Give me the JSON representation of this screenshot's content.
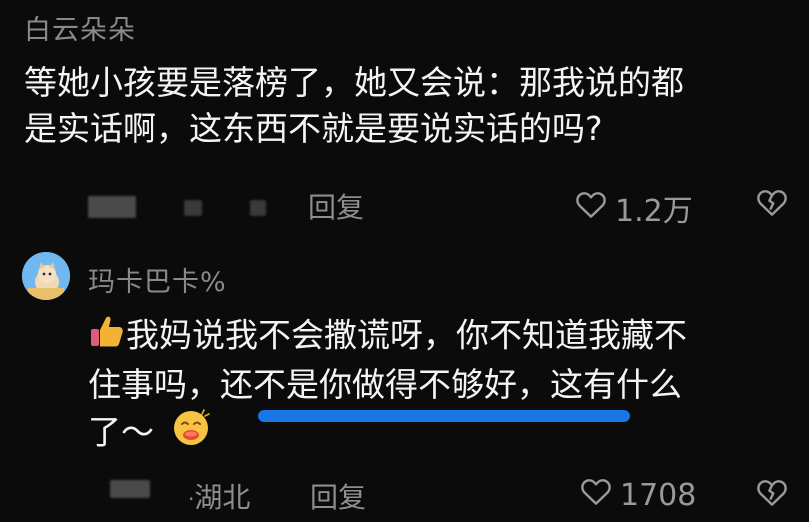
{
  "comments": [
    {
      "author": "白云朵朵",
      "text_line1": "等她小孩要是落榜了，她又会说：那我说的都",
      "text_line2": "是实话啊，这东西不就是要说实话的吗?",
      "reply_label": "回复",
      "like_count": "1.2万"
    },
    {
      "author": "玛卡巴卡%",
      "text_line1": "我妈说我不会撒谎呀，你不知道我藏不",
      "text_line2": "住事吗，还不是你做得不够好，这有什么",
      "text_line3": "了～",
      "location": "湖北",
      "reply_label": "回复",
      "like_count": "1708"
    }
  ],
  "colors": {
    "background": "#0b0b0b",
    "text": "#f4f4f4",
    "muted": "#8a8a8a",
    "highlight_stroke": "#1877e6"
  },
  "icons": [
    "heart-outline-icon",
    "broken-heart-icon",
    "thumbs-up-emoji",
    "face-emoji",
    "avatar"
  ]
}
